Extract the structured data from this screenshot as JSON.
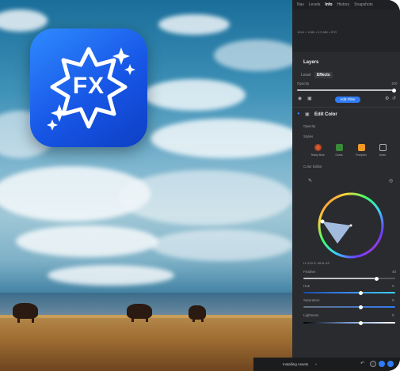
{
  "top_tabs": [
    "Nav",
    "Levels",
    "Info",
    "History",
    "Snapshots"
  ],
  "active_tab": "Info",
  "image_info": "1616 × 1080 • 3.5 MB • JPG",
  "layers": {
    "title": "Layers",
    "segments": [
      "Local",
      "Effects"
    ],
    "active_segment": "Effects",
    "opacity_label": "Opacity",
    "opacity_value": "100",
    "add_filter_label": "Add Filter"
  },
  "edit_color": {
    "title": "Edit Color",
    "opacity_label": "Opacity",
    "styles_label": "Styles",
    "styles": [
      "Teddy Blue",
      "Grass",
      "Pumpkin",
      "Moss"
    ],
    "color_editor_label": "Color Editor",
    "hsl_readout": "H: 213 S: 26 B: 49",
    "feather_label": "Feather",
    "feather_value": "40",
    "hue_label": "Hue",
    "hue_value": "0",
    "saturation_label": "Saturation",
    "saturation_value": "0",
    "lightness_label": "Lightness",
    "lightness_value": "0"
  },
  "status": {
    "text": "Installing Assets"
  },
  "app_icon": {
    "label": "FX",
    "icon": "sparkle-badge-icon"
  },
  "colors": {
    "accent": "#2f7cf6",
    "panel_bg": "#2a2b2e",
    "icon_blue": "#1756e6"
  }
}
